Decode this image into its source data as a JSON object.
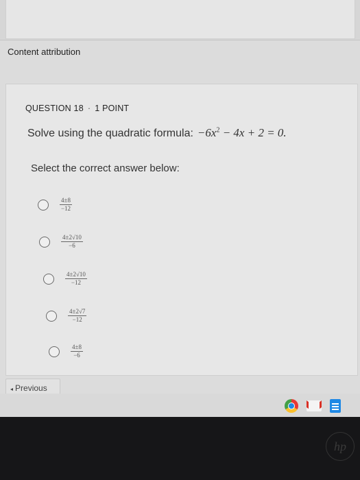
{
  "header": {
    "attribution_link": "Content attribution"
  },
  "question": {
    "number_label": "QUESTION 18",
    "separator": "·",
    "points_label": "1 POINT",
    "prompt_text": "Solve using the quadratic formula:",
    "equation_lhs_prefix": "−6x",
    "equation_exponent": "2",
    "equation_lhs_suffix": " − 4x + 2 = 0.",
    "instruction": "Select the correct answer below:"
  },
  "options": [
    {
      "numerator": "4±8",
      "denominator": "−12",
      "selected": false
    },
    {
      "numerator": "4±2√10",
      "denominator": "−6",
      "selected": false
    },
    {
      "numerator": "4±2√10",
      "denominator": "−12",
      "selected": false
    },
    {
      "numerator": "4±2√7",
      "denominator": "−12",
      "selected": false
    },
    {
      "numerator": "4±8",
      "denominator": "−6",
      "selected": false
    }
  ],
  "navigation": {
    "previous_label": "Previous",
    "previous_chevron": "◂"
  },
  "taskbar": {
    "icons": [
      "chrome-icon",
      "gmail-icon",
      "docs-icon"
    ]
  },
  "device": {
    "logo_text": "hp"
  },
  "colors": {
    "page_background": "#dcdcdc",
    "card_background": "#e7e7e7",
    "text_primary": "#333333",
    "radio_border": "#6a6a6a"
  }
}
